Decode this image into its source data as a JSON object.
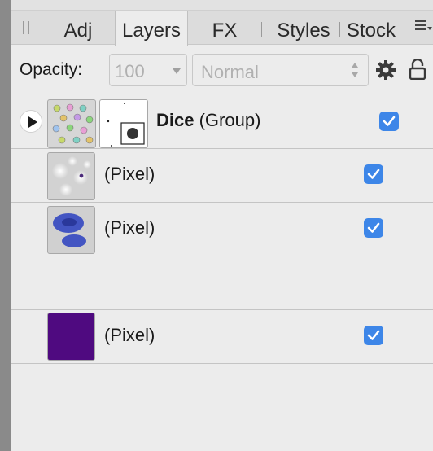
{
  "tabs": [
    {
      "label": "Adj",
      "active": false
    },
    {
      "label": "Layers",
      "active": true
    },
    {
      "label": "FX",
      "active": false
    },
    {
      "label": "Styles",
      "active": false
    },
    {
      "label": "Stock",
      "active": false
    }
  ],
  "toolbar": {
    "opacity_label": "Opacity:",
    "opacity_value": "100",
    "blend_mode": "Normal"
  },
  "layers": [
    {
      "name": "Dice",
      "type": "(Group)",
      "visible": true,
      "expandable": true
    },
    {
      "name": "",
      "type": "(Pixel)",
      "visible": true
    },
    {
      "name": "",
      "type": "(Pixel)",
      "visible": true
    },
    {
      "name": "",
      "type": "(Pixel)",
      "visible": true
    }
  ],
  "colors": {
    "checkbox": "#3d86e8",
    "purple_fill": "#4f0a80",
    "blue_blob": "#2a3fc0"
  },
  "icons": [
    "gear-icon",
    "lock-icon",
    "panel-menu-icon",
    "expand-arrow-icon"
  ]
}
